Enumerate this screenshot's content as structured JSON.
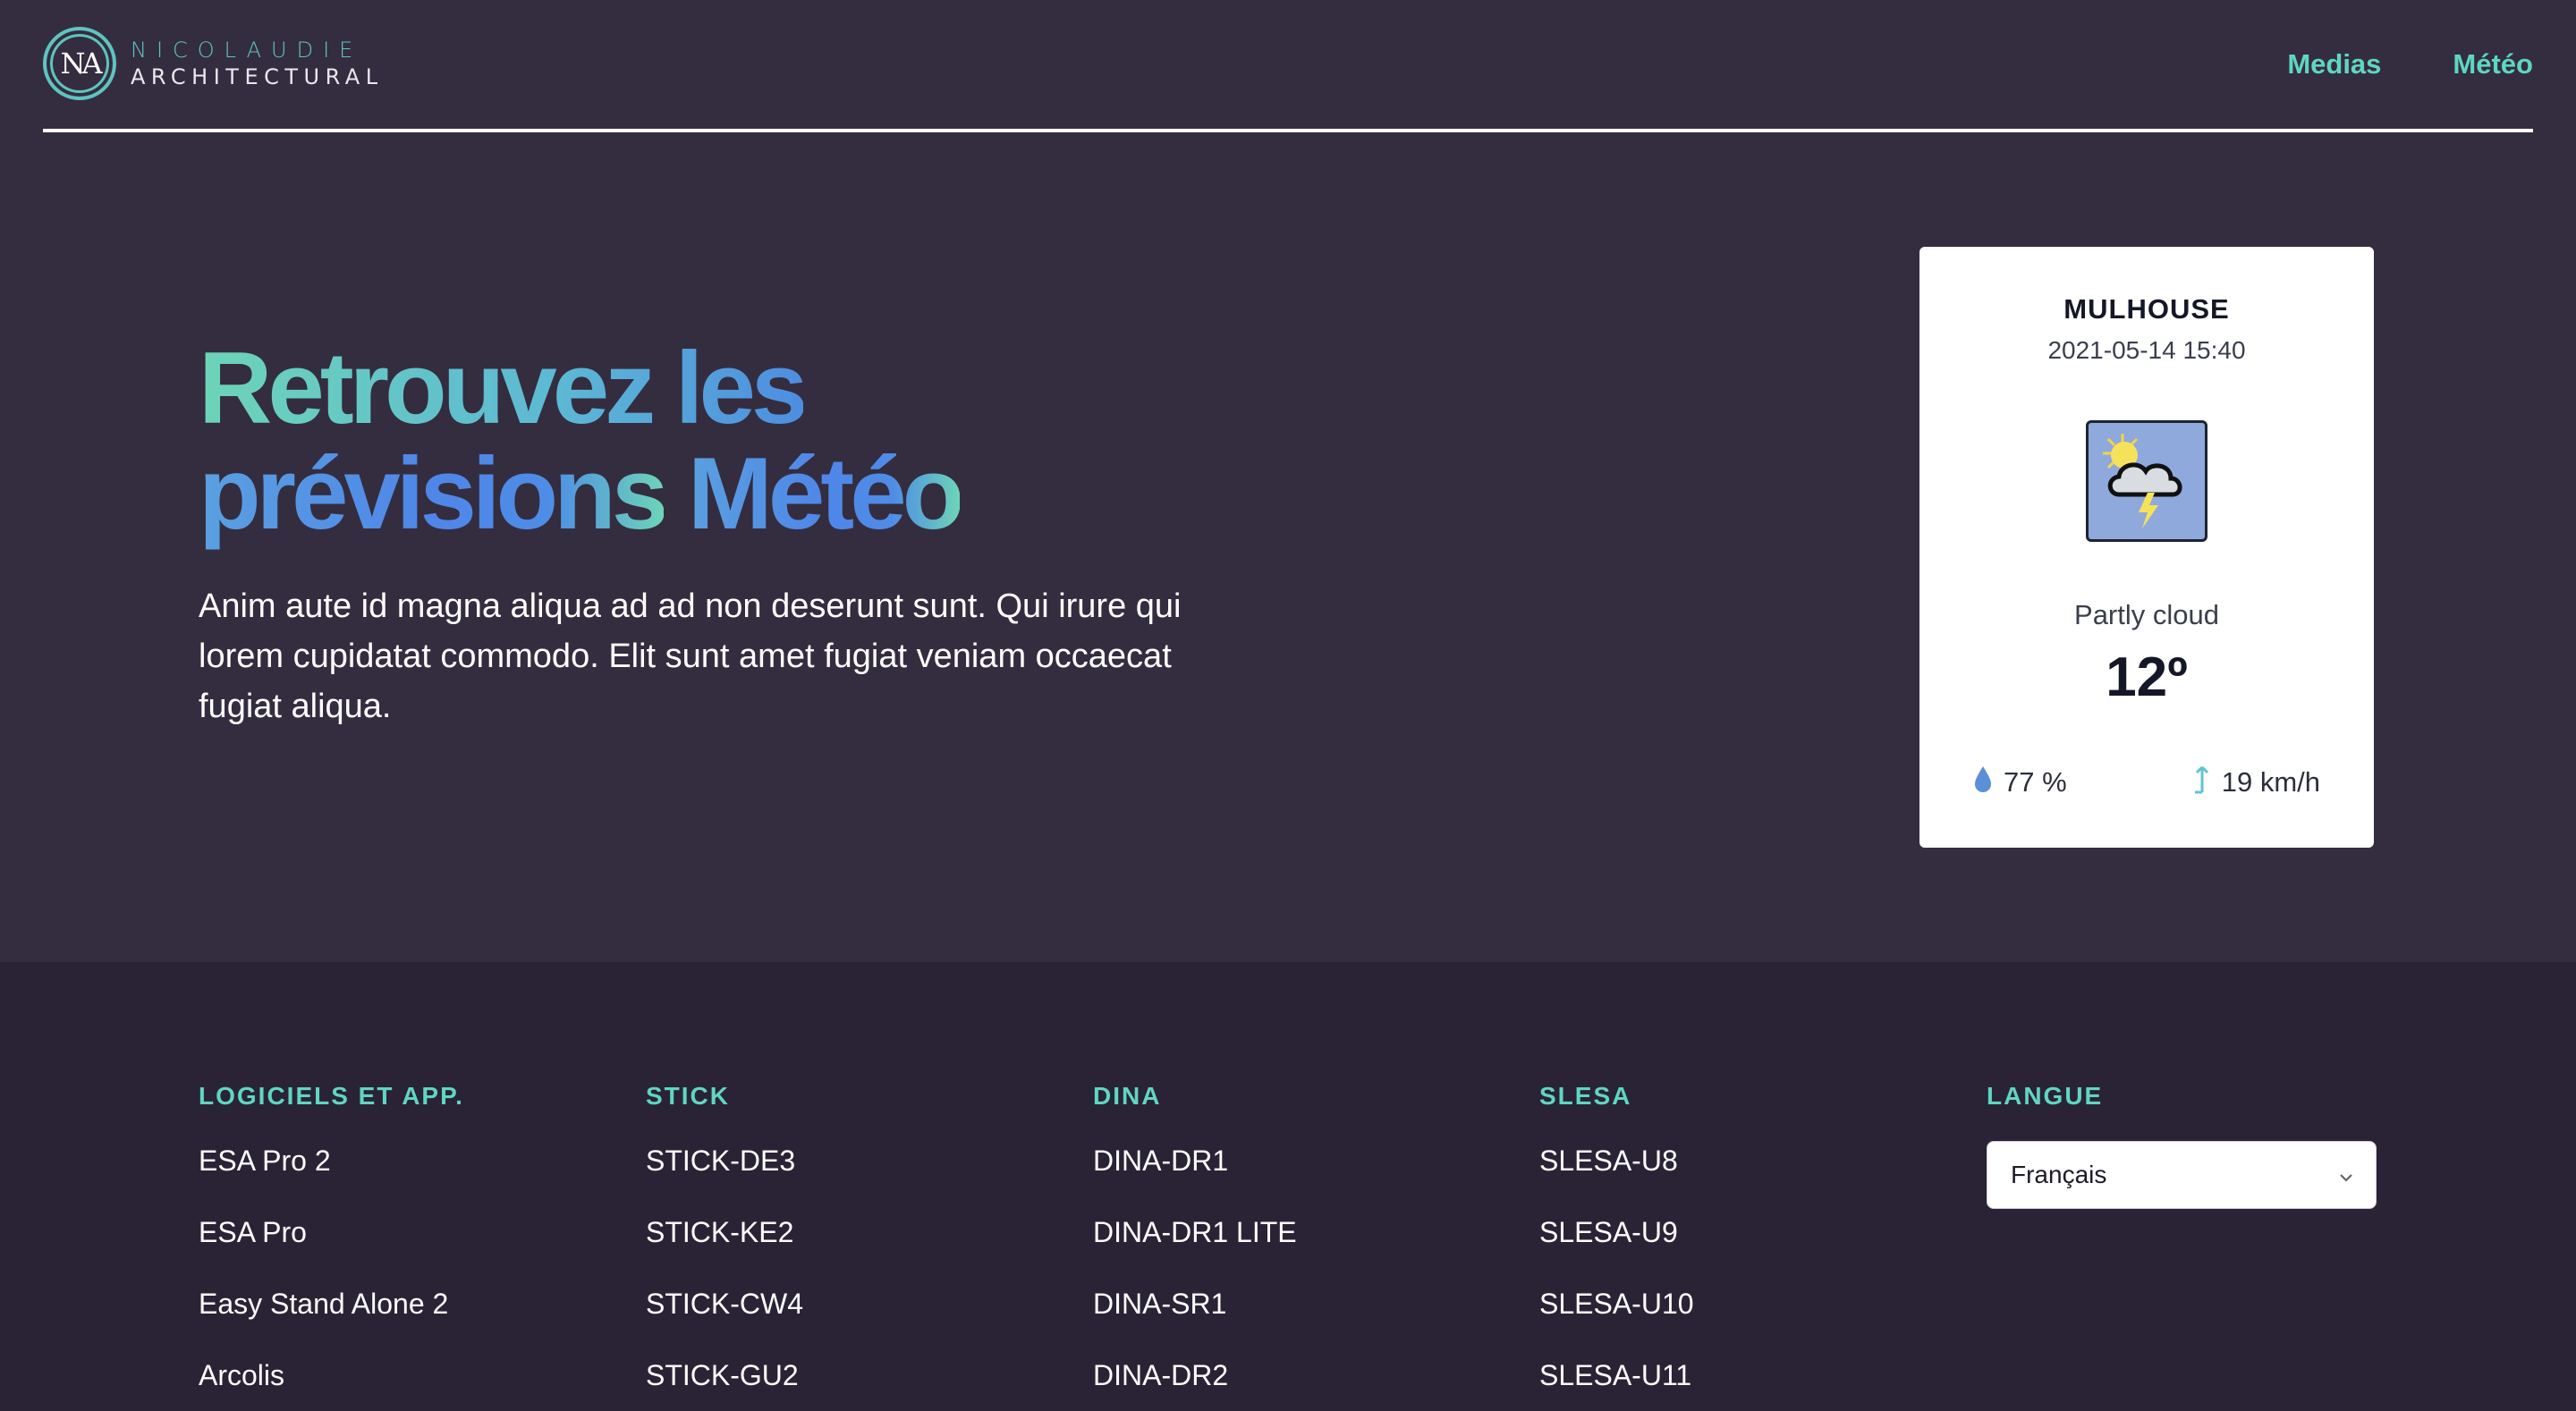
{
  "header": {
    "logo_mark": "NA",
    "logo_line1": "NICOLAUDIE",
    "logo_line2": "ARCHITECTURAL",
    "nav": [
      {
        "label": "Medias"
      },
      {
        "label": "Météo"
      }
    ]
  },
  "hero": {
    "title_line1": "Retrouvez les",
    "title_line2_a": "prévisions",
    "title_line2_b": "Météo",
    "text": "Anim aute id magna aliqua ad ad non deserunt sunt. Qui irure qui lorem cupidatat commodo. Elit sunt amet fugiat veniam occaecat fugiat aliqua."
  },
  "weather": {
    "city": "MULHOUSE",
    "datetime": "2021-05-14 15:40",
    "icon": "partly-cloudy-thunder-icon",
    "condition": "Partly cloud",
    "temperature": "12º",
    "humidity": "77 %",
    "wind": "19 km/h"
  },
  "footer": {
    "columns": [
      {
        "title": "LOGICIELS ET APP.",
        "items": [
          "ESA Pro 2",
          "ESA Pro",
          "Easy Stand Alone 2",
          "Arcolis"
        ]
      },
      {
        "title": "STICK",
        "items": [
          "STICK-DE3",
          "STICK-KE2",
          "STICK-CW4",
          "STICK-GU2"
        ]
      },
      {
        "title": "DINA",
        "items": [
          "DINA-DR1",
          "DINA-DR1 LITE",
          "DINA-SR1",
          "DINA-DR2"
        ]
      },
      {
        "title": "SLESA",
        "items": [
          "SLESA-U8",
          "SLESA-U9",
          "SLESA-U10",
          "SLESA-U11"
        ]
      }
    ],
    "language": {
      "title": "LANGUE",
      "selected": "Français"
    }
  },
  "colors": {
    "background": "#342d3f",
    "footer_background": "#2a2335",
    "accent": "#5fd6c2",
    "gradient_blue": "#4e8de0"
  }
}
